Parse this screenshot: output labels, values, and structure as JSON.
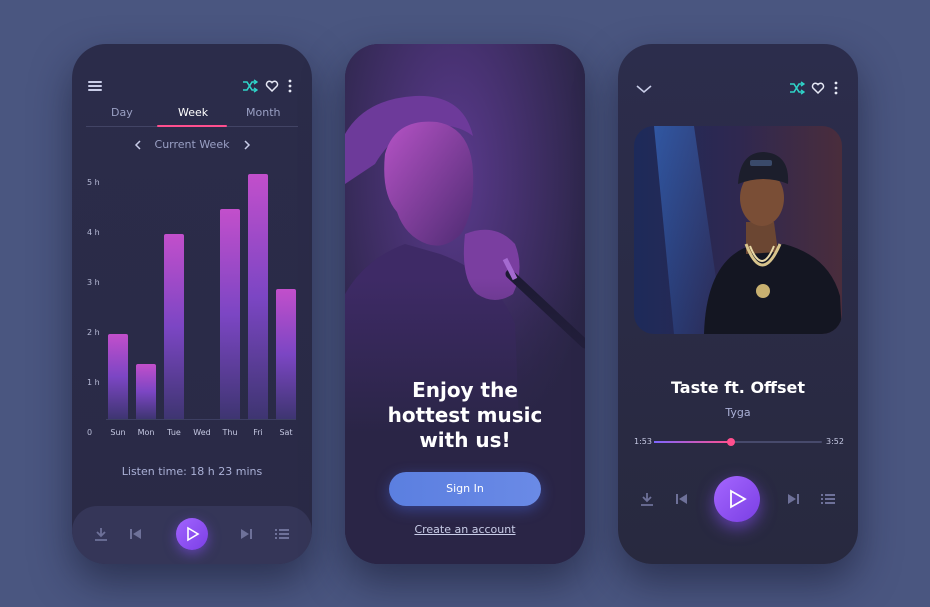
{
  "stats_screen": {
    "tabs": [
      {
        "label": "Day",
        "active": false
      },
      {
        "label": "Week",
        "active": true
      },
      {
        "label": "Month",
        "active": false
      }
    ],
    "period_label": "Current Week",
    "listen_time": "Listen time: 18 h 23 mins",
    "icons": [
      "menu-icon",
      "shuffle-icon",
      "heart-icon",
      "more-icon"
    ]
  },
  "chart_data": {
    "type": "bar",
    "categories": [
      "Sun",
      "Mon",
      "Tue",
      "Wed",
      "Thu",
      "Fri",
      "Sat"
    ],
    "values": [
      1.7,
      1.1,
      3.7,
      0,
      4.2,
      4.9,
      2.6
    ],
    "y_ticks": [
      "0",
      "1 h",
      "2 h",
      "3 h",
      "4 h",
      "5 h"
    ],
    "ylim": [
      0,
      5
    ],
    "colors": {
      "top": "#c24fcb",
      "bottom": "#3e3571"
    }
  },
  "welcome_screen": {
    "headline_lines": [
      "Enjoy the",
      "hottest music",
      "with us!"
    ],
    "signin_label": "Sign In",
    "create_account_label": "Create an account"
  },
  "player_screen": {
    "song_title": "Taste ft. Offset",
    "artist": "Tyga",
    "elapsed": "1:53",
    "duration": "3:52",
    "progress": 0.46
  },
  "colors": {
    "accent_pink": "#ff4f8e",
    "accent_purple": "#9b5cff",
    "accent_teal": "#2fd3c8",
    "button_blue": "#5b7fe0"
  }
}
